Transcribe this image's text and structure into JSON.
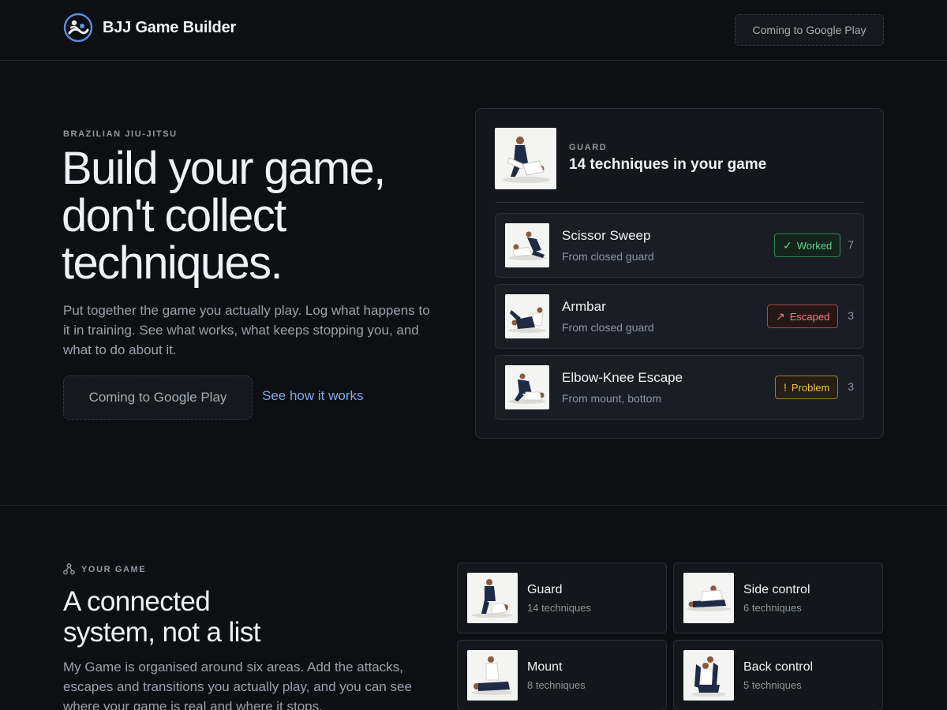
{
  "header": {
    "brand_name": "BJJ Game Builder",
    "cta_label": "Coming to Google Play"
  },
  "hero": {
    "eyebrow": "BRAZILIAN JIU-JITSU",
    "title_line1": "Build your game,",
    "title_line2": "don't collect",
    "title_line3": "techniques.",
    "description": "Put together the game you actually play. Log what happens to it in training. See what works, what keeps stopping you, and what to do about it.",
    "cta_label": "Coming to Google Play",
    "link_label": "See how it works"
  },
  "preview": {
    "eyebrow": "GUARD",
    "title": "14 techniques in your game",
    "techniques": [
      {
        "name": "Scissor Sweep",
        "from": "From closed guard",
        "status": "Worked",
        "status_glyph": "✓",
        "count": "7"
      },
      {
        "name": "Armbar",
        "from": "From closed guard",
        "status": "Escaped",
        "status_glyph": "↗",
        "count": "3"
      },
      {
        "name": "Elbow-Knee Escape",
        "from": "From mount, bottom",
        "status": "Problem",
        "status_glyph": "!",
        "count": "3"
      }
    ]
  },
  "your_game": {
    "eyebrow": "YOUR GAME",
    "title_line1": "A connected",
    "title_line2": "system, not a list",
    "description": "My Game is organised around six areas. Add the attacks, escapes and transitions you actually play, and you can see where your game is real and where it stops.",
    "areas": [
      {
        "name": "Guard",
        "count": "14 techniques"
      },
      {
        "name": "Side control",
        "count": "6 techniques"
      },
      {
        "name": "Mount",
        "count": "8 techniques"
      },
      {
        "name": "Back control",
        "count": "5 techniques"
      }
    ]
  },
  "colors": {
    "background": "#0d0f13",
    "accent_link": "#7fa9e8",
    "worked": "#5cd48c",
    "escaped": "#ef7c7c",
    "problem": "#f0bf4c"
  }
}
